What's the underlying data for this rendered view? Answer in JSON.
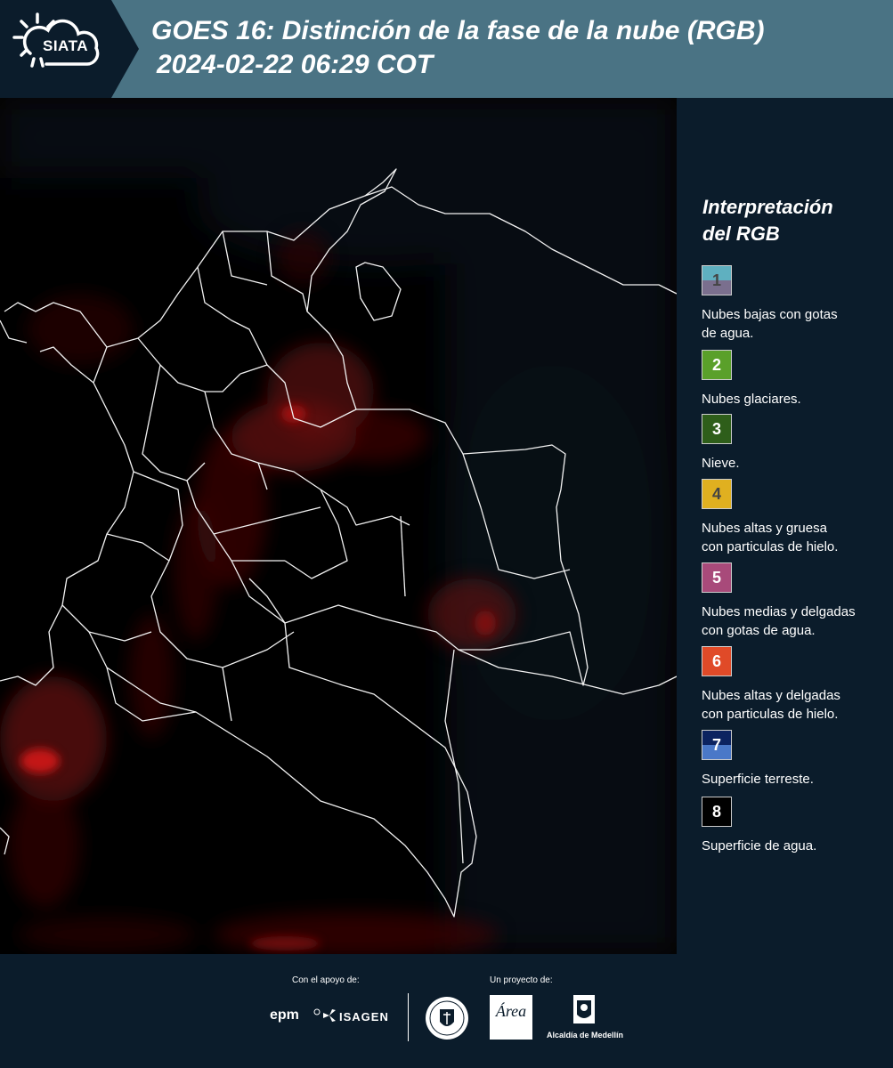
{
  "header": {
    "logo_text": "SIATA",
    "title_line1": "GOES 16: Distinción de la fase de la nube (RGB)",
    "title_line2": "2024-02-22 06:29 COT",
    "background_color": "#4a7384"
  },
  "legend": {
    "title_line1": "Interpretación",
    "title_line2": "del RGB",
    "items": [
      {
        "number": "1",
        "label_line1": "Nubes bajas con gotas",
        "label_line2": "de agua.",
        "color_top": "#5fb0c0",
        "color_bottom": "#7a6f8e",
        "number_color": "#444444"
      },
      {
        "number": "2",
        "label_line1": "Nubes glaciares.",
        "label_line2": "",
        "color_top": "#5aa02a",
        "color_bottom": "#5aa02a",
        "number_color": "#ffffff"
      },
      {
        "number": "3",
        "label_line1": "Nieve.",
        "label_line2": "",
        "color_top": "#2e5e1a",
        "color_bottom": "#2e5e1a",
        "number_color": "#ffffff"
      },
      {
        "number": "4",
        "label_line1": "Nubes altas y gruesa",
        "label_line2": "con particulas de hielo.",
        "color_top": "#e0b020",
        "color_bottom": "#e0b020",
        "number_color": "#444444"
      },
      {
        "number": "5",
        "label_line1": "Nubes medias y delgadas",
        "label_line2": "con gotas de agua.",
        "color_top": "#a84a7a",
        "color_bottom": "#a84a7a",
        "number_color": "#ffffff"
      },
      {
        "number": "6",
        "label_line1": "Nubes altas y delgadas",
        "label_line2": "con particulas de hielo.",
        "color_top": "#e04a28",
        "color_bottom": "#e04a28",
        "number_color": "#ffffff"
      },
      {
        "number": "7",
        "label_line1": "Superficie terreste.",
        "label_line2": "",
        "color_top": "#0c2360",
        "color_bottom": "#4a78c8",
        "number_color": "#ffffff"
      },
      {
        "number": "8",
        "label_line1": "Superficie de agua.",
        "label_line2": "",
        "color_top": "#000000",
        "color_bottom": "#000000",
        "number_color": "#ffffff"
      }
    ]
  },
  "footer": {
    "support_label": "Con el apoyo de:",
    "project_label": "Un proyecto de:",
    "epm_text": "epm",
    "isagen_text": "ISAGEN",
    "metropolitana_text": "Área",
    "alcaldia_text": "Alcaldía de Medellín"
  }
}
